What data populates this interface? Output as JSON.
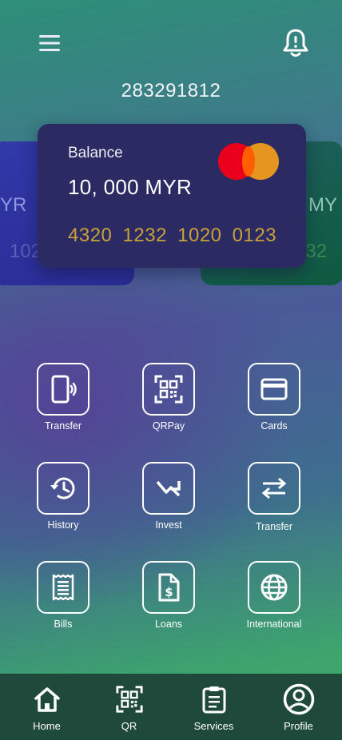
{
  "account": {
    "number": "283291812"
  },
  "side_cards": {
    "left": {
      "text1": "YR",
      "text2": "102"
    },
    "right": {
      "text1": "MY",
      "text2": "232"
    }
  },
  "card": {
    "balance_label": "Balance",
    "balance_value": "10, 000 MYR",
    "number": "4320 1232 1020 0123",
    "brand_icon": "mastercard-logo"
  },
  "services": [
    {
      "label": "Transfer",
      "icon": "phone-transfer-icon"
    },
    {
      "label": "QRPay",
      "icon": "qr-scan-icon"
    },
    {
      "label": "Cards",
      "icon": "credit-card-icon"
    },
    {
      "label": "History",
      "icon": "history-icon"
    },
    {
      "label": "Invest",
      "icon": "trend-up-icon"
    },
    {
      "label": "Transfer",
      "icon": "swap-arrows-icon"
    },
    {
      "label": "Bills",
      "icon": "receipt-icon"
    },
    {
      "label": "Loans",
      "icon": "loan-document-icon"
    },
    {
      "label": "International",
      "icon": "globe-icon"
    }
  ],
  "nav": [
    {
      "label": "Home",
      "icon": "home-icon"
    },
    {
      "label": "QR",
      "icon": "qr-icon"
    },
    {
      "label": "Services",
      "icon": "clipboard-icon"
    },
    {
      "label": "Profile",
      "icon": "profile-icon"
    }
  ]
}
